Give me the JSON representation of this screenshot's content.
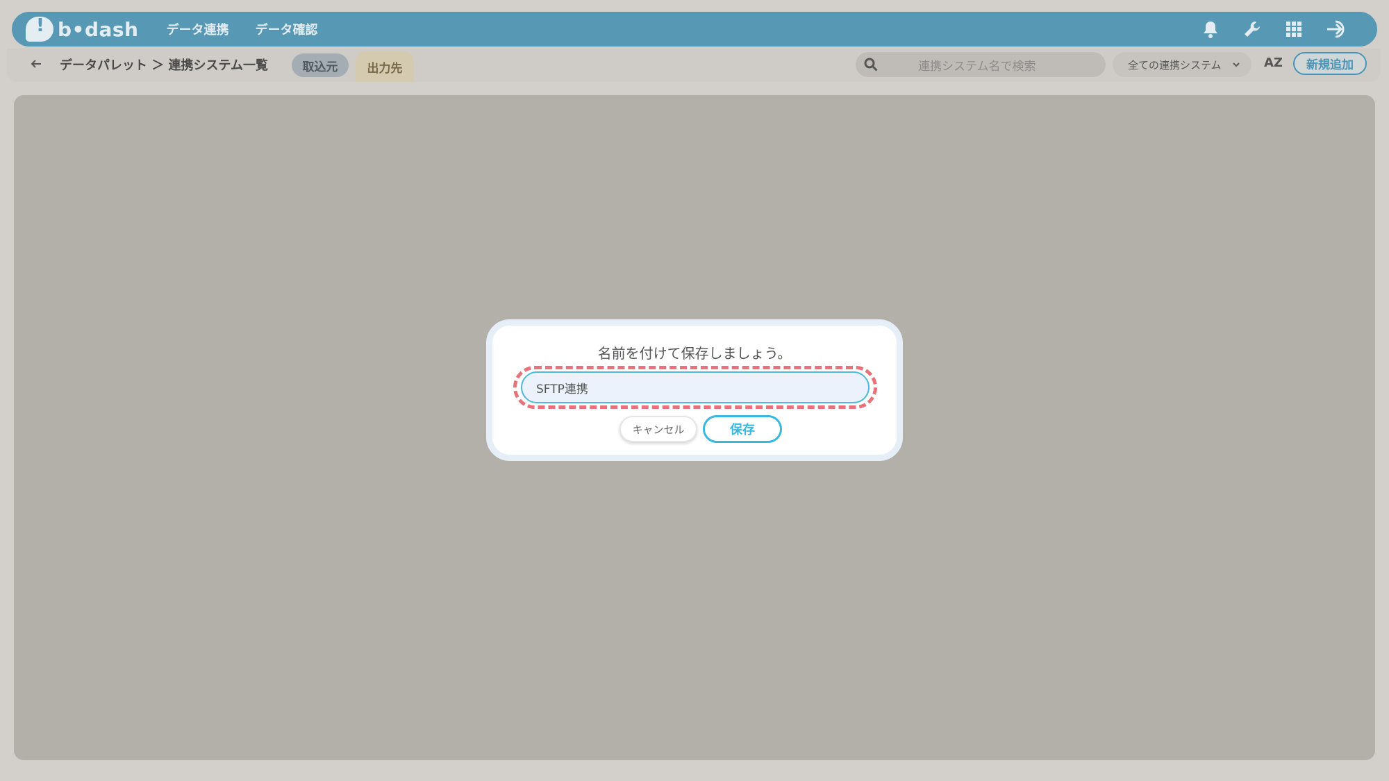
{
  "header": {
    "logo_text": "b•dash",
    "nav": [
      "データ連携",
      "データ確認"
    ],
    "icons": [
      "bell-icon",
      "wrench-icon",
      "grid-icon",
      "logout-icon"
    ]
  },
  "subbar": {
    "breadcrumb": "データパレット ＞ 連携システム一覧",
    "tab_import": "取込元",
    "tab_output": "出力先",
    "search_placeholder": "連携システム名で検索",
    "filter_value": "全ての連携システム",
    "sort_label": "AZ",
    "new_button": "新規追加"
  },
  "dialog": {
    "title": "名前を付けて保存しましょう。",
    "input_value": "SFTP連携",
    "cancel_label": "キャンセル",
    "save_label": "保存"
  },
  "colors": {
    "header": "#5799b5",
    "accent": "#38b7e0",
    "highlight": "#e8727a"
  }
}
